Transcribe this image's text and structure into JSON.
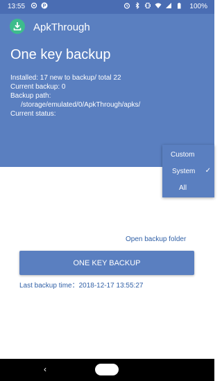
{
  "status_bar": {
    "time": "13:55",
    "battery": "100%",
    "icons": [
      "notification-icon",
      "p-app-icon",
      "alarm-icon",
      "bluetooth-icon",
      "vibrate-icon",
      "wifi-icon",
      "signal-icon",
      "battery-icon"
    ]
  },
  "app": {
    "name": "ApkThrough",
    "logo_icon": "apk-download-icon",
    "brand_color": "#5a7fc0",
    "logo_color": "#3dbc8c"
  },
  "header": {
    "title": "One key backup",
    "installed": "Installed: 17 new to backup/ total 22",
    "current_backup": "Current backup: 0",
    "backup_path_label": "Backup path:",
    "backup_path": "/storage/emulated/0/ApkThrough/apks/",
    "current_status": "Current status:"
  },
  "menu": {
    "items": [
      {
        "label": "Custom",
        "checked": false
      },
      {
        "label": "System",
        "checked": true
      },
      {
        "label": "All",
        "checked": false
      }
    ]
  },
  "main": {
    "open_folder": "Open backup folder",
    "button_label": "ONE KEY BACKUP",
    "last_backup": "Last backup time：2018-12-17 13:55:27"
  },
  "nav": {
    "back_icon": "back-icon",
    "home_icon": "home-icon"
  }
}
